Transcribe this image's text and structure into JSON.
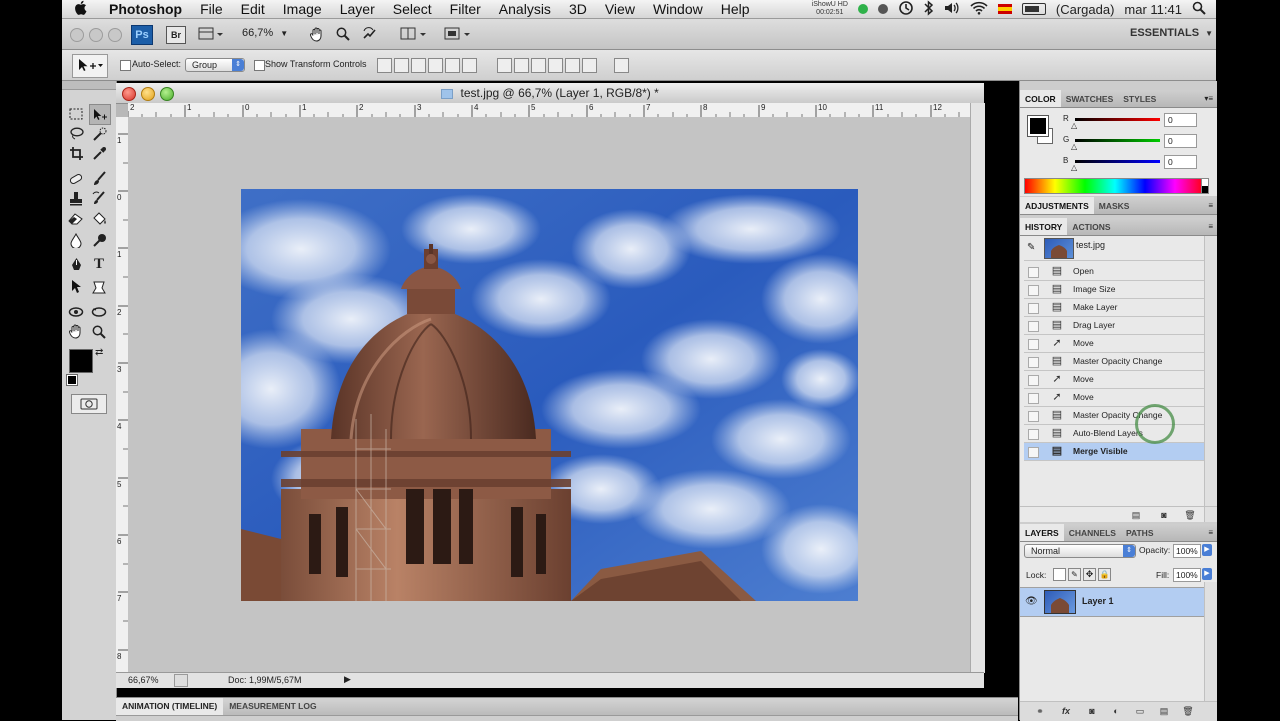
{
  "menubar": {
    "apple": "",
    "app_name": "Photoshop",
    "menus": [
      "File",
      "Edit",
      "Image",
      "Layer",
      "Select",
      "Filter",
      "Analysis",
      "3D",
      "View",
      "Window",
      "Help"
    ],
    "recorder_name": "iShowU HD",
    "recorder_time": "00:02:51",
    "battery_status": "(Cargada)",
    "clock": "mar 11:41"
  },
  "appbar": {
    "ps_badge": "Ps",
    "br_badge": "Br",
    "zoom": "66,7%",
    "workspace": "ESSENTIALS"
  },
  "options": {
    "auto_select_label": "Auto-Select:",
    "auto_select_value": "Group",
    "show_transform_label": "Show Transform Controls"
  },
  "document": {
    "title": "test.jpg @ 66,7% (Layer 1, RGB/8*) *",
    "h_ruler_labels": [
      "2",
      "1",
      "0",
      "1",
      "2",
      "3",
      "4",
      "5",
      "6",
      "7",
      "8",
      "9",
      "10",
      "11",
      "12"
    ],
    "v_ruler_labels": [
      "1",
      "0",
      "1",
      "2",
      "3",
      "4",
      "5",
      "6",
      "7",
      "8"
    ],
    "status_zoom": "66,67%",
    "status_doc": "Doc: 1,99M/5,67M"
  },
  "bottom_panel": {
    "tabs": [
      "ANIMATION (TIMELINE)",
      "MEASUREMENT LOG"
    ]
  },
  "color_panel": {
    "tabs": [
      "COLOR",
      "SWATCHES",
      "STYLES"
    ],
    "r_label": "R",
    "g_label": "G",
    "b_label": "B",
    "r_value": "0",
    "g_value": "0",
    "b_value": "0"
  },
  "adjustments_panel": {
    "tabs": [
      "ADJUSTMENTS",
      "MASKS"
    ]
  },
  "history_panel": {
    "tabs": [
      "HISTORY",
      "ACTIONS"
    ],
    "snapshot": "test.jpg",
    "items": [
      {
        "label": "Open",
        "icon": "step-icon"
      },
      {
        "label": "Image Size",
        "icon": "step-icon"
      },
      {
        "label": "Make Layer",
        "icon": "step-icon"
      },
      {
        "label": "Drag Layer",
        "icon": "step-icon"
      },
      {
        "label": "Move",
        "icon": "move-icon"
      },
      {
        "label": "Master Opacity Change",
        "icon": "step-icon"
      },
      {
        "label": "Move",
        "icon": "move-icon"
      },
      {
        "label": "Move",
        "icon": "move-icon"
      },
      {
        "label": "Master Opacity Change",
        "icon": "step-icon"
      },
      {
        "label": "Auto-Blend Layers",
        "icon": "step-icon"
      },
      {
        "label": "Merge Visible",
        "icon": "step-icon"
      }
    ],
    "selected_index": 10
  },
  "layers_panel": {
    "tabs": [
      "LAYERS",
      "CHANNELS",
      "PATHS"
    ],
    "blend_mode": "Normal",
    "opacity_label": "Opacity:",
    "opacity_value": "100%",
    "lock_label": "Lock:",
    "fill_label": "Fill:",
    "fill_value": "100%",
    "layers": [
      {
        "name": "Layer 1"
      }
    ]
  }
}
